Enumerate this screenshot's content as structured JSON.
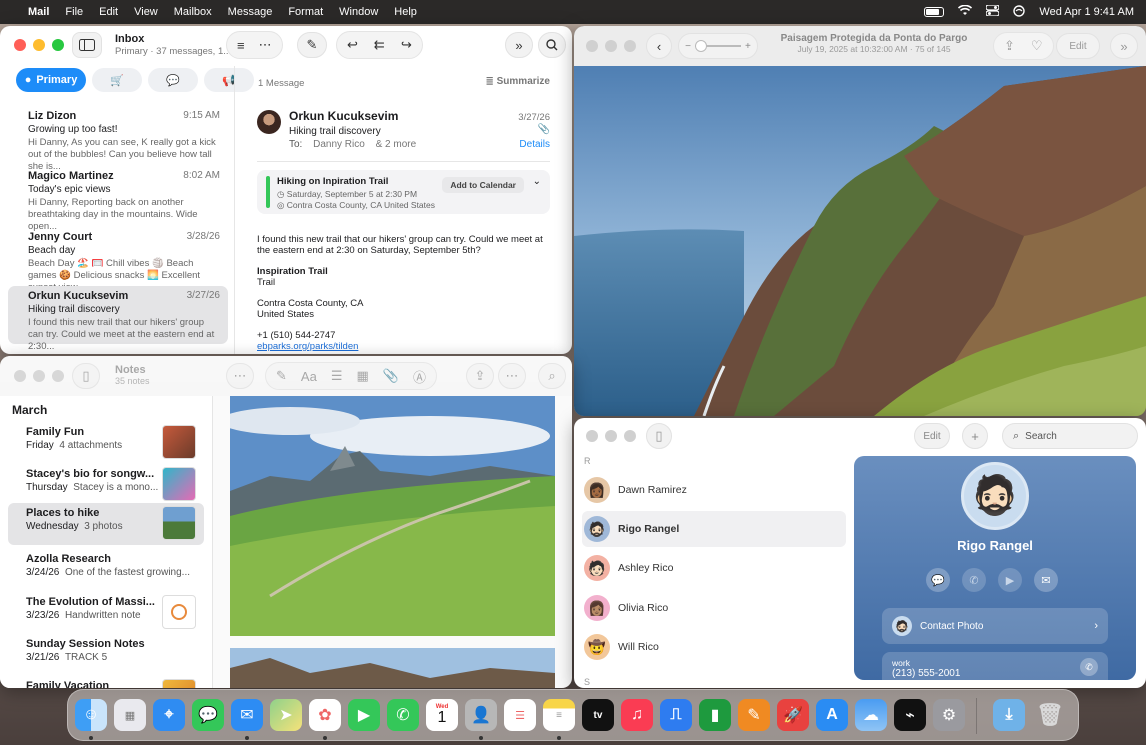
{
  "menubar": {
    "app": "Mail",
    "menus": [
      "File",
      "Edit",
      "View",
      "Mailbox",
      "Message",
      "Format",
      "Window",
      "Help"
    ],
    "datetime": "Wed Apr 1  9:41 AM"
  },
  "mail": {
    "title": "Inbox",
    "subtitle": "Primary · 37 messages, 1...",
    "filters": {
      "primary": "Primary"
    },
    "messages": [
      {
        "name": "Liz Dizon",
        "time": "9:15 AM",
        "subject": "Growing up too fast!",
        "preview": "Hi Danny, As you can see, K really got a kick out of the bubbles! Can you believe how tall she is..."
      },
      {
        "name": "Magico Martinez",
        "time": "8:02 AM",
        "subject": "Today's epic views",
        "preview": "Hi Danny, Reporting back on another breathtaking day in the mountains. Wide open..."
      },
      {
        "name": "Jenny Court",
        "time": "3/28/26",
        "subject": "Beach day",
        "preview": "Beach Day 🏖️ 🥅 Chill vibes 🏐 Beach games 🍪 Delicious snacks 🌅 Excellent sunset view..."
      },
      {
        "name": "Orkun Kucuksevim",
        "time": "3/27/26",
        "subject": "Hiking trail discovery",
        "preview": "I found this new trail that our hikers' group can try. Could we meet at the eastern end at 2:30..."
      }
    ],
    "reader": {
      "count": "1 Message",
      "summarize": "Summarize",
      "from": "Orkun Kucuksevim",
      "date": "3/27/26",
      "subject": "Hiking trail discovery",
      "to_label": "To:",
      "to": "Danny Rico",
      "more": "& 2 more",
      "details": "Details",
      "event_title": "Hiking on Inpiration Trail",
      "event_time": "Saturday, September 5 at 2:30 PM",
      "event_place": "Contra Costa County, CA United States",
      "add_calendar": "Add to Calendar",
      "body": "I found this new trail that our hikers' group can try. Could we meet at the eastern end at 2:30 on Saturday, September 5th?",
      "place_name": "Inspiration Trail",
      "place_type": "Trail",
      "addr1": "Contra Costa County, CA",
      "addr2": "United States",
      "phone": "+1 (510) 544-2747",
      "link": "ebparks.org/parks/tilden"
    }
  },
  "photos": {
    "title": "Paisagem Protegida da Ponta do Pargo",
    "subtitle": "July 19, 2025 at 10:32:00 AM · 75 of 145",
    "edit": "Edit"
  },
  "notes": {
    "title": "Notes",
    "count": "35 notes",
    "section": "March",
    "items": [
      {
        "title": "Family Fun",
        "date": "Friday",
        "info": "4 attachments"
      },
      {
        "title": "Stacey's bio for songw...",
        "date": "Thursday",
        "info": "Stacey is a mono..."
      },
      {
        "title": "Places to hike",
        "date": "Wednesday",
        "info": "3 photos"
      },
      {
        "title": "Azolla Research",
        "date": "3/24/26",
        "info": "One of the fastest growing..."
      },
      {
        "title": "The Evolution of Massi...",
        "date": "3/23/26",
        "info": "Handwritten note"
      },
      {
        "title": "Sunday Session Notes",
        "date": "3/21/26",
        "info": "TRACK 5"
      },
      {
        "title": "Family Vacation",
        "date": "",
        "info": ""
      }
    ]
  },
  "contacts": {
    "edit": "Edit",
    "search_placeholder": "Search",
    "section_r": "R",
    "section_s": "S",
    "list": [
      "Dawn Ramirez",
      "Rigo Rangel",
      "Ashley Rico",
      "Olivia Rico",
      "Will Rico"
    ],
    "card": {
      "name": "Rigo Rangel",
      "contact_photo": "Contact Photo",
      "phone_label": "work",
      "phone": "(213) 555-2001"
    }
  },
  "dock": {
    "apps": [
      "Finder",
      "Launchpad",
      "Safari",
      "Messages",
      "Mail",
      "Maps",
      "Photos",
      "FaceTime",
      "Phone",
      "Calendar",
      "Contacts",
      "Reminders",
      "Notes",
      "TV",
      "Music",
      "Keynote",
      "Numbers",
      "Pages",
      "Rocket",
      "App Store",
      "Weather",
      "Stocks",
      "System Settings",
      "Downloads",
      "Trash"
    ],
    "calendar_month": "Wed",
    "calendar_day": "1"
  }
}
